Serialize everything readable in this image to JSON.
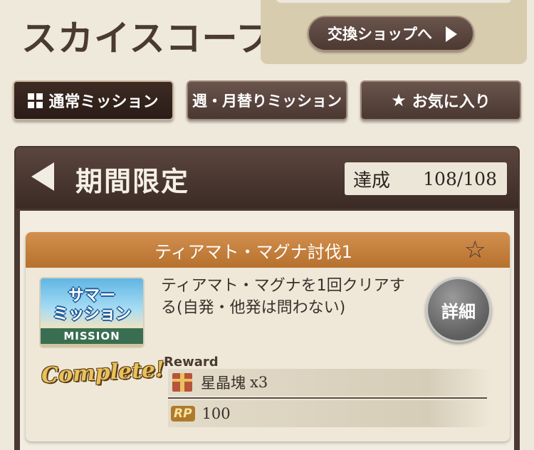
{
  "header": {
    "title": "スカイスコープ",
    "shop_button": "交換ショップへ"
  },
  "tabs": [
    {
      "label": "通常ミッション",
      "active": true
    },
    {
      "label": "週・月替りミッション",
      "active": false
    },
    {
      "label": "お気に入り",
      "active": false
    }
  ],
  "section": {
    "title": "期間限定",
    "progress_label": "達成",
    "progress_value": "108/108"
  },
  "mission": {
    "name": "ティアマト・マグナ討伐1",
    "thumb_line1": "サマー",
    "thumb_line2": "ミッション",
    "thumb_band": "MISSION",
    "description": "ティアマト・マグナを1回クリアする(自発・他発は問わない)",
    "detail_button": "詳細",
    "status": "Complete!",
    "reward_label": "Reward",
    "rewards": [
      {
        "icon": "gift-icon",
        "name": "星晶塊",
        "amount": "x3"
      },
      {
        "icon": "rp-icon",
        "icon_text": "RP",
        "name": "",
        "amount": "100"
      }
    ]
  },
  "colors": {
    "background": "#efe9dc",
    "tab_bg": "#4a3731",
    "card_header": "#c47d3b",
    "frame": "#4a3832"
  }
}
